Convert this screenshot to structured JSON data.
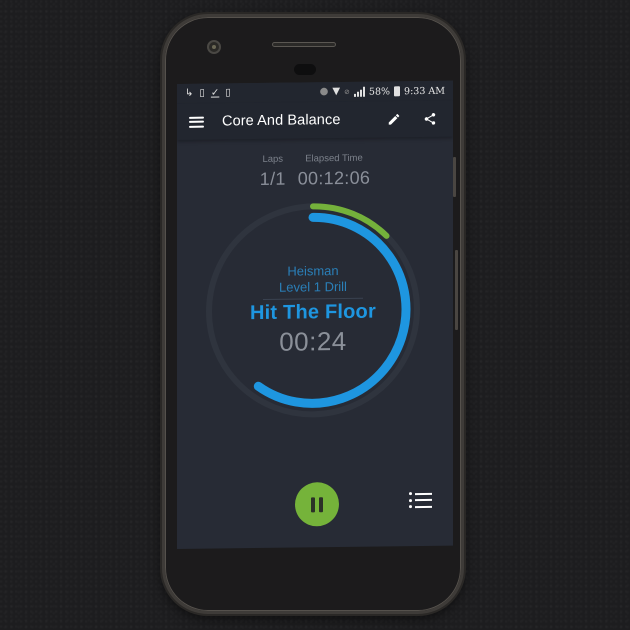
{
  "status_bar": {
    "left_icons": [
      "share-arrow-icon",
      "sim-card-icon",
      "check-download-icon",
      "sim-card-icon"
    ],
    "right_icons": [
      "bluetooth-icon",
      "wifi-icon",
      "mute-icon",
      "signal-icon"
    ],
    "battery_percent": "58%",
    "time": "9:33 AM"
  },
  "toolbar": {
    "title": "Core And Balance",
    "menu_icon": "hamburger-menu-icon",
    "edit_icon": "pencil-icon",
    "share_icon": "share-icon"
  },
  "stats": {
    "laps_label": "Laps",
    "laps_value": "1/1",
    "elapsed_label": "Elapsed Time",
    "elapsed_value": "00:12:06"
  },
  "timer": {
    "routine_name": "Heisman",
    "drill_name": "Level 1 Drill",
    "exercise": "Hit The Floor",
    "countdown": "00:24",
    "outer_progress": 0.125,
    "inner_progress": 0.6,
    "colors": {
      "outer": "#74b13b",
      "inner": "#1e96e0",
      "track": "#2f343e"
    }
  },
  "controls": {
    "pause_icon": "pause-icon",
    "list_icon": "list-icon"
  }
}
